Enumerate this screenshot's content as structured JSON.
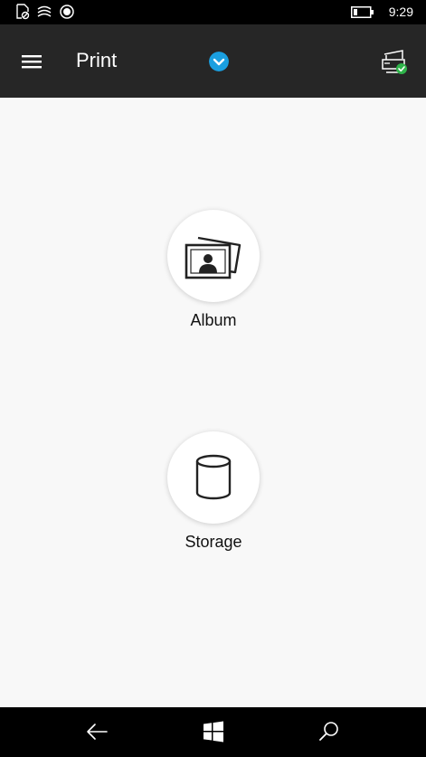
{
  "status_bar": {
    "time": "9:29",
    "icons": [
      "notification-icon",
      "wifi-icon",
      "record-icon",
      "battery-icon"
    ]
  },
  "app_bar": {
    "title": "Print",
    "icons": [
      "hamburger-menu-icon",
      "chevron-down-icon",
      "printer-status-icon"
    ],
    "accent_color": "#1a9fe0",
    "ok_color": "#2fb34a"
  },
  "tiles": [
    {
      "label": "Album",
      "icon": "album-icon"
    },
    {
      "label": "Storage",
      "icon": "storage-icon"
    }
  ],
  "nav_bar": {
    "icons": [
      "back-arrow-icon",
      "windows-start-icon",
      "search-icon"
    ]
  }
}
